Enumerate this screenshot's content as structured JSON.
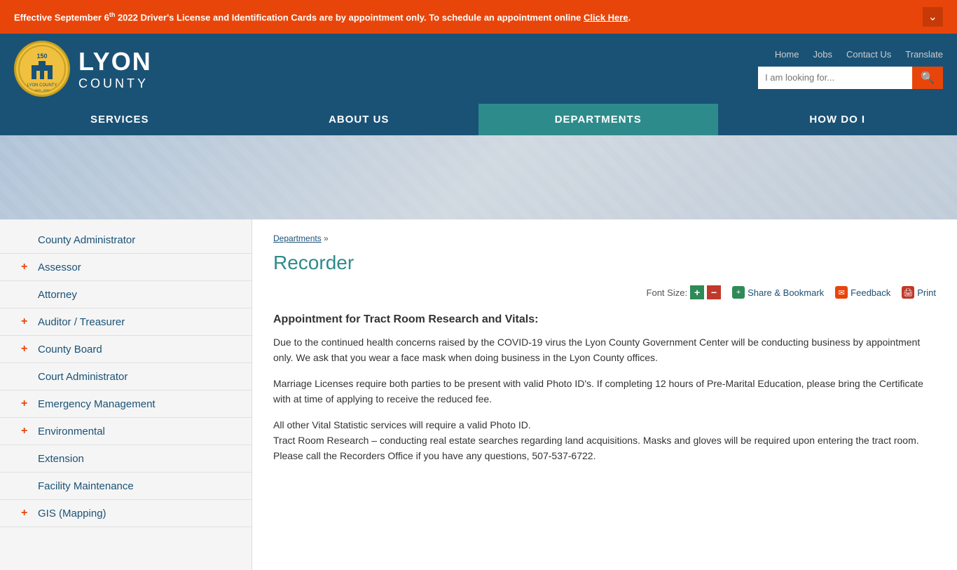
{
  "alert": {
    "text_before": "Effective September 6",
    "sup": "th",
    "text_after": " 2022 Driver's License and Identification Cards are by appointment only. To schedule an appointment online ",
    "link_text": "Click Here",
    "link_url": "#"
  },
  "header": {
    "logo_text_line1": "LYON",
    "logo_text_line2": "COUNTY",
    "nav_links": [
      {
        "label": "Home",
        "url": "#"
      },
      {
        "label": "Jobs",
        "url": "#"
      },
      {
        "label": "Contact Us",
        "url": "#"
      },
      {
        "label": "Translate",
        "url": "#"
      }
    ],
    "search_placeholder": "I am looking for..."
  },
  "main_nav": [
    {
      "label": "SERVICES",
      "active": false
    },
    {
      "label": "ABOUT US",
      "active": false
    },
    {
      "label": "DEPARTMENTS",
      "active": true
    },
    {
      "label": "HOW DO I",
      "active": false
    }
  ],
  "sidebar": {
    "items": [
      {
        "label": "County Administrator",
        "has_plus": false,
        "indent": true
      },
      {
        "label": "Assessor",
        "has_plus": true,
        "indent": false
      },
      {
        "label": "Attorney",
        "has_plus": false,
        "indent": true
      },
      {
        "label": "Auditor / Treasurer",
        "has_plus": true,
        "indent": false
      },
      {
        "label": "County Board",
        "has_plus": true,
        "indent": false
      },
      {
        "label": "Court Administrator",
        "has_plus": false,
        "indent": true
      },
      {
        "label": "Emergency Management",
        "has_plus": true,
        "indent": false
      },
      {
        "label": "Environmental",
        "has_plus": true,
        "indent": false
      },
      {
        "label": "Extension",
        "has_plus": false,
        "indent": true
      },
      {
        "label": "Facility Maintenance",
        "has_plus": false,
        "indent": true
      },
      {
        "label": "GIS (Mapping)",
        "has_plus": true,
        "indent": false
      }
    ]
  },
  "breadcrumb": {
    "link": "Departments",
    "separator": "»"
  },
  "page": {
    "title": "Recorder",
    "font_size_label": "Font Size:",
    "plus_label": "+",
    "minus_label": "−",
    "share_label": "Share & Bookmark",
    "feedback_label": "Feedback",
    "print_label": "Print"
  },
  "article": {
    "title": "Appointment for Tract Room Research and Vitals:",
    "paragraphs": [
      "Due to the continued health concerns raised by the COVID-19 virus the Lyon County Government Center will be conducting business by appointment only. We ask that you wear a face mask when doing business in the Lyon County offices.",
      "Marriage Licenses require both parties to be present with valid Photo ID's.  If completing 12 hours of Pre-Marital Education, please bring the Certificate with at time of applying to receive the reduced fee.",
      "All other Vital Statistic services will require a valid Photo ID.\nTract Room Research – conducting real estate searches regarding land acquisitions.  Masks and gloves will be required upon entering the tract room. Please call the Recorders Office if you have any questions, 507-537-6722."
    ]
  }
}
